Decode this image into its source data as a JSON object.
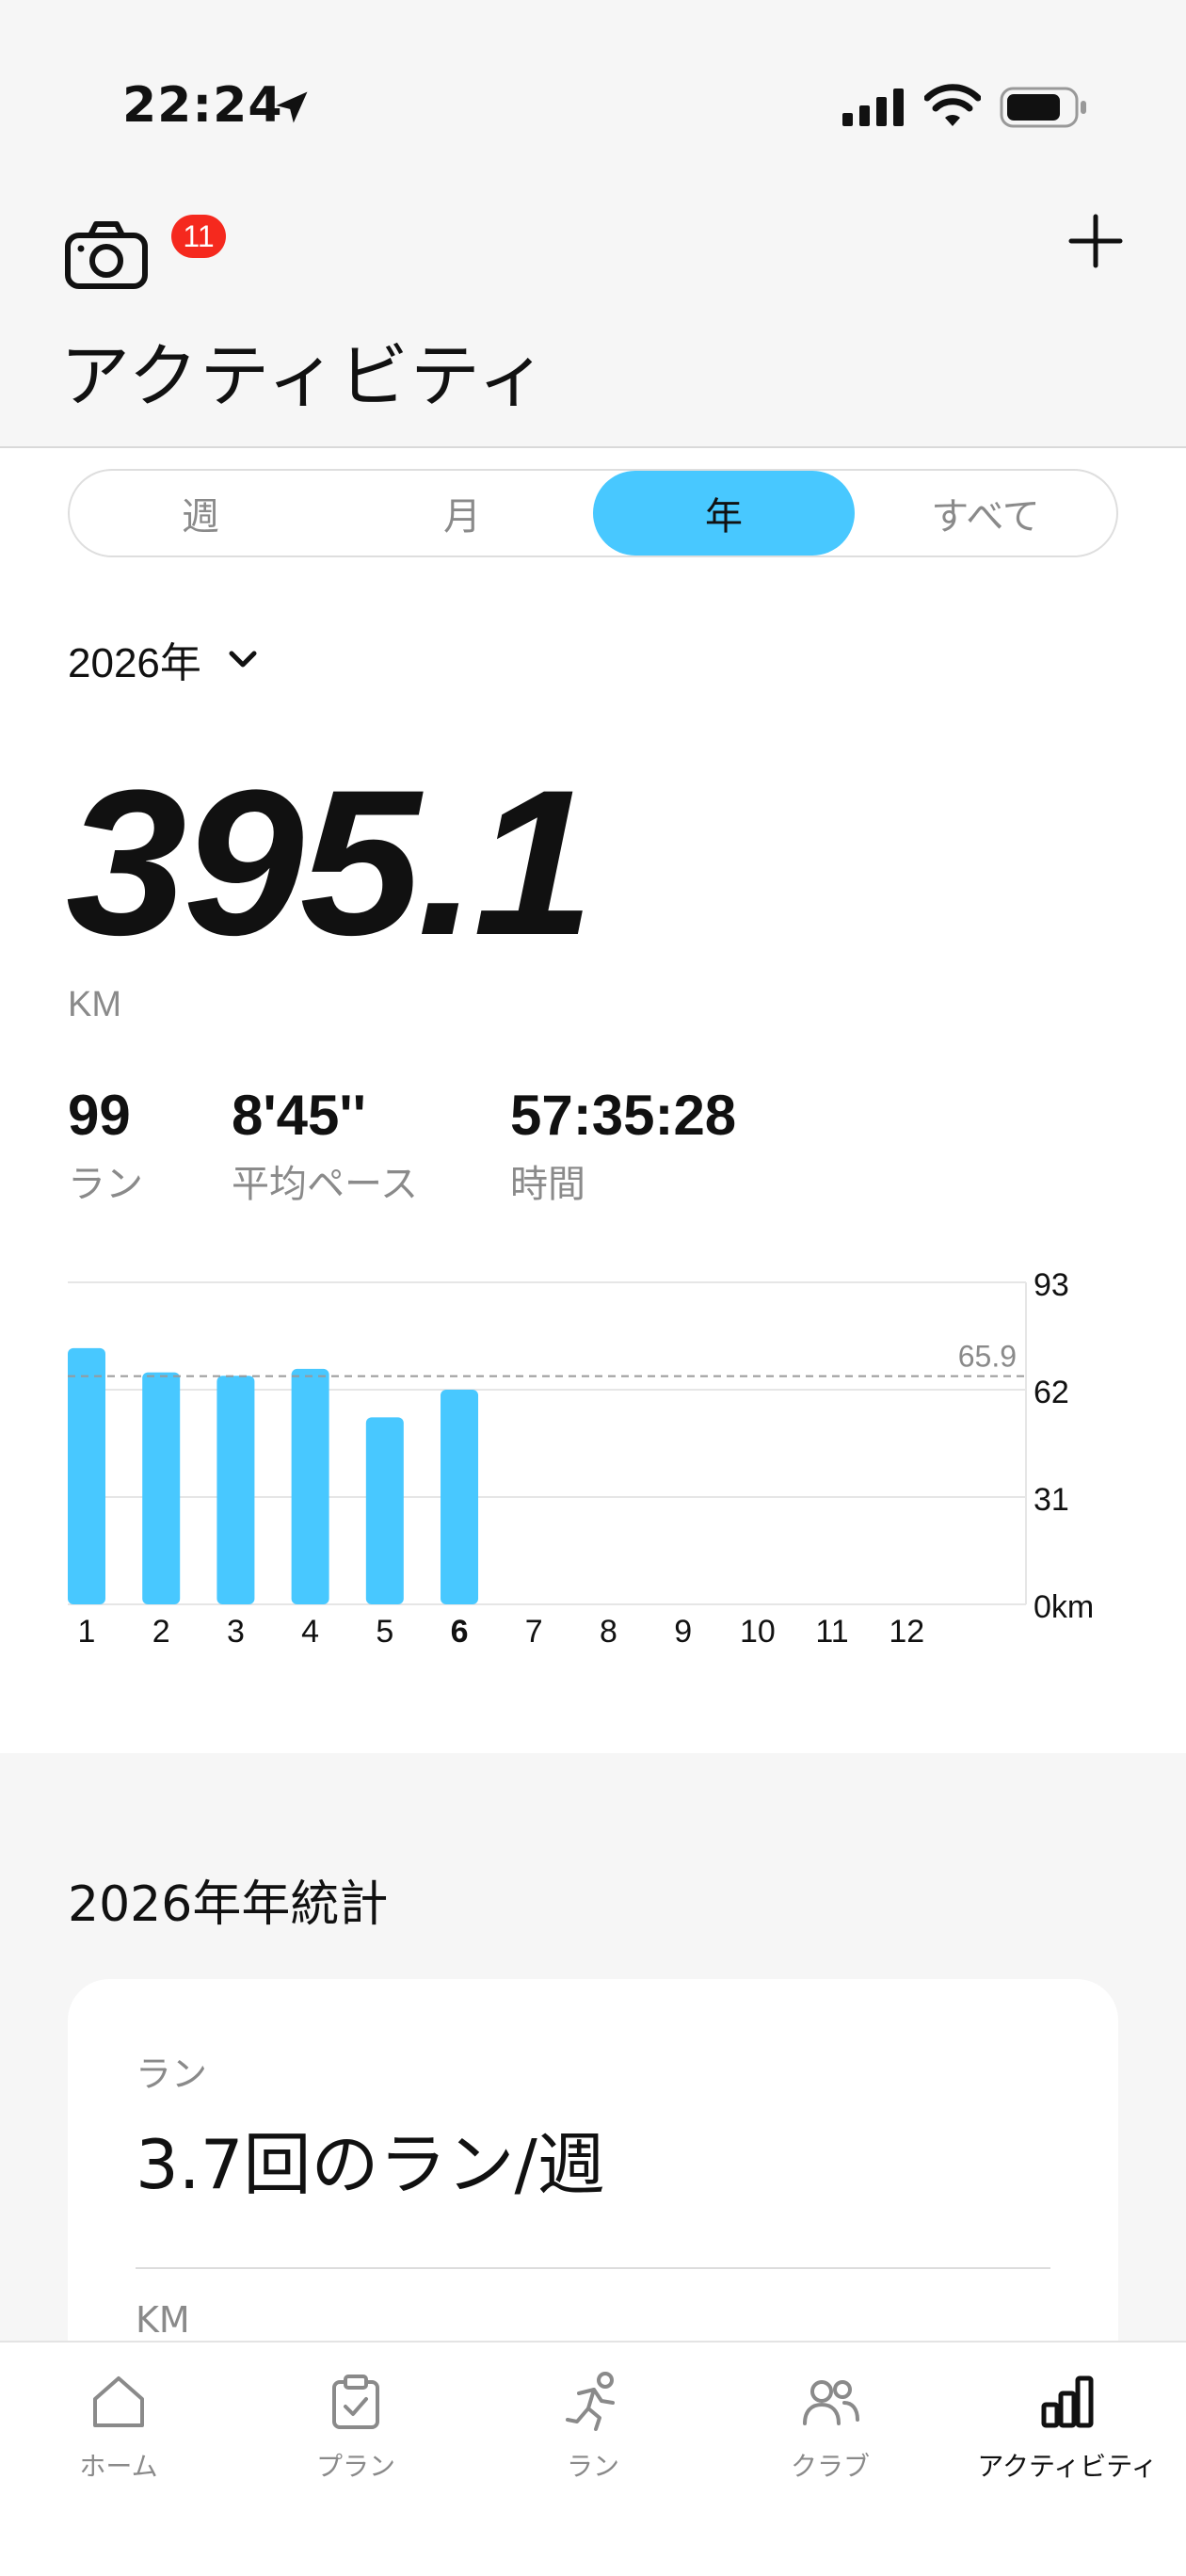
{
  "status_bar": {
    "time": "22:24"
  },
  "header": {
    "title": "アクティビティ",
    "notification_count": "11"
  },
  "segments": [
    "週",
    "月",
    "年",
    "すべて"
  ],
  "active_segment": "年",
  "year_selector": "2026年",
  "summary": {
    "distance": "395.1",
    "unit": "KM",
    "runs_value": "99",
    "runs_label": "ラン",
    "pace_value": "8'45''",
    "pace_label": "平均ペース",
    "time_value": "57:35:28",
    "time_label": "時間"
  },
  "chart_data": {
    "type": "bar",
    "categories": [
      "1",
      "2",
      "3",
      "4",
      "5",
      "6",
      "7",
      "8",
      "9",
      "10",
      "11",
      "12"
    ],
    "values": [
      74,
      67,
      66,
      68,
      54,
      62,
      0,
      0,
      0,
      0,
      0,
      0
    ],
    "ylim": [
      0,
      93
    ],
    "yticks": [
      "93",
      "62",
      "31",
      "0km"
    ],
    "average": 65.9,
    "average_label": "65.9",
    "bar_color": "#48c8ff",
    "highlight_category": "6"
  },
  "yearly_stats": {
    "title": "2026年年統計",
    "card_label": "ラン",
    "card_value": "3.7回のラン/週",
    "next_label": "KM"
  },
  "tabbar": {
    "home": "ホーム",
    "plan": "プラン",
    "run": "ラン",
    "club": "クラブ",
    "activity": "アクティビティ"
  },
  "colors": {
    "accent": "#48c8ff",
    "badge": "#f5291e"
  }
}
